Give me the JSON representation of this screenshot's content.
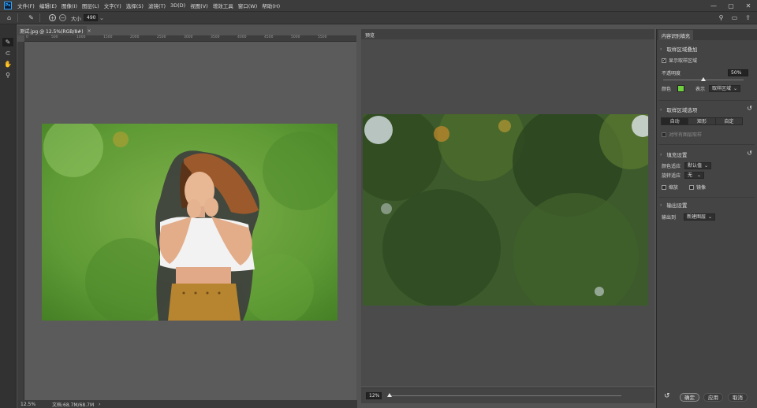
{
  "menubar": {
    "items": [
      "文件(F)",
      "编辑(E)",
      "图像(I)",
      "图层(L)",
      "文字(Y)",
      "选择(S)",
      "滤镜(T)",
      "3D(D)",
      "视图(V)",
      "增效工具",
      "窗口(W)",
      "帮助(H)"
    ],
    "minimize": "—",
    "maximize": "▢",
    "close": "✕"
  },
  "options": {
    "size_label": "大小",
    "size_value": "490"
  },
  "document": {
    "tab_title": "测试.jpg @ 12.5%(RGB/8#)",
    "close": "×",
    "ruler_ticks": [
      "0",
      "500",
      "1000",
      "1500",
      "2000",
      "2500",
      "3000",
      "3500",
      "4000",
      "4500",
      "5000",
      "5500"
    ]
  },
  "status": {
    "zoom": "12.5%",
    "doc_size": "文档:68.7M/68.7M",
    "arrow": "›"
  },
  "preview": {
    "tab_label": "预览",
    "zoom_value": "12%",
    "zoom_fraction": 0
  },
  "panel": {
    "tab_label": "内容识别填充",
    "overlay_section": "取样区域叠加",
    "show_sampling_label": "显示取样区域",
    "show_sampling_checked": true,
    "opacity_label": "不透明度",
    "opacity_value": "50%",
    "opacity_fraction": 0.5,
    "color_label": "颜色",
    "overlay_color": "#6fcf3e",
    "indicates_label": "表示",
    "indicates_value": "取样区域",
    "sampling_options_section": "取样区域选项",
    "sampling_modes": [
      "自动",
      "矩形",
      "自定"
    ],
    "sample_all_layers_label": "对所有图层取样",
    "fill_settings_section": "填充设置",
    "color_adaptation_label": "颜色适应",
    "color_adaptation_value": "默认值",
    "rotation_adaptation_label": "旋转适应",
    "rotation_adaptation_value": "无",
    "scale_label": "缩放",
    "mirror_label": "镜像",
    "output_section": "输出设置",
    "output_to_label": "输出到",
    "output_to_value": "新建图层",
    "ok_label": "确定",
    "apply_label": "应用",
    "cancel_label": "取消"
  },
  "icons": {
    "home": "⌂",
    "brush": "✎",
    "add_mode": "+",
    "subtract_mode": "−",
    "chevron": "⌄",
    "search": "⚲",
    "workspace": "▭",
    "share": "⇪",
    "tool_brush": "✎",
    "tool_lasso": "⊂",
    "tool_hand": "✋",
    "tool_zoom": "⚲",
    "reset": "↺",
    "section_chevron": "›",
    "checkmark": "✓"
  },
  "colors": {
    "accent": "#31a8ff",
    "overlay_green": "#6fcf3e"
  }
}
